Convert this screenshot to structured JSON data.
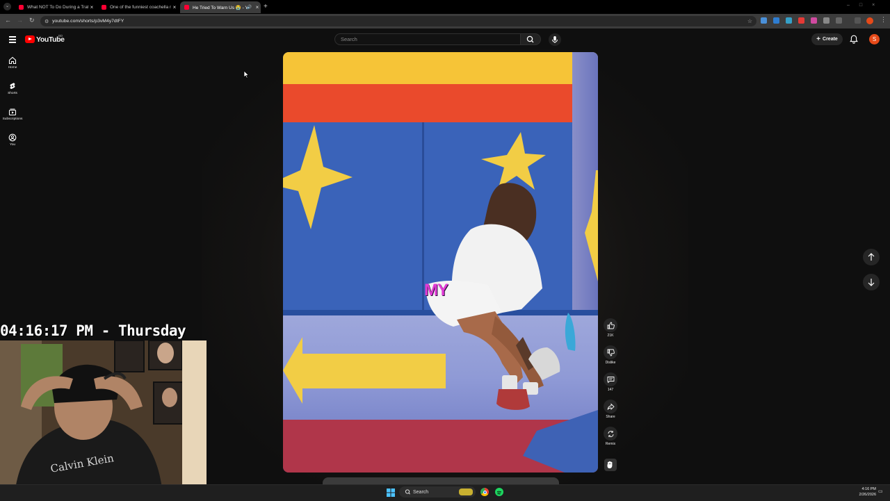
{
  "browser": {
    "tabs": [
      {
        "title": "What NOT To Do During a Traffic",
        "active": false
      },
      {
        "title": "One of the funniest coachella m",
        "active": false
      },
      {
        "title": "He Tried To Warn Us 😭 - Yo",
        "active": true
      }
    ],
    "url": "youtube.com/shorts/p3vM4y7dtFY"
  },
  "youtube": {
    "logo_text": "YouTube",
    "logo_country": "BD",
    "search_placeholder": "Search",
    "create_label": "Create",
    "avatar_letter": "S",
    "sidebar": [
      {
        "label": "Home",
        "icon": "home-icon"
      },
      {
        "label": "Shorts",
        "icon": "shorts-icon"
      },
      {
        "label": "Subscriptions",
        "icon": "subscriptions-icon"
      },
      {
        "label": "You",
        "icon": "you-icon"
      }
    ],
    "video": {
      "caption": "MY"
    },
    "actions": {
      "like_count": "21K",
      "dislike_label": "Dislike",
      "comment_count": "147",
      "share_label": "Share",
      "remix_label": "Remix"
    }
  },
  "overlay": {
    "clock": "04:16:17 PM - Thursday",
    "shirt_text": "Calvin Klein"
  },
  "taskbar": {
    "search_label": "Search",
    "time": "4:16 PM",
    "date": "2/26/2026"
  },
  "colors": {
    "youtube_red": "#ff0000",
    "avatar": "#e64a19",
    "caption": "#e23cd6"
  }
}
